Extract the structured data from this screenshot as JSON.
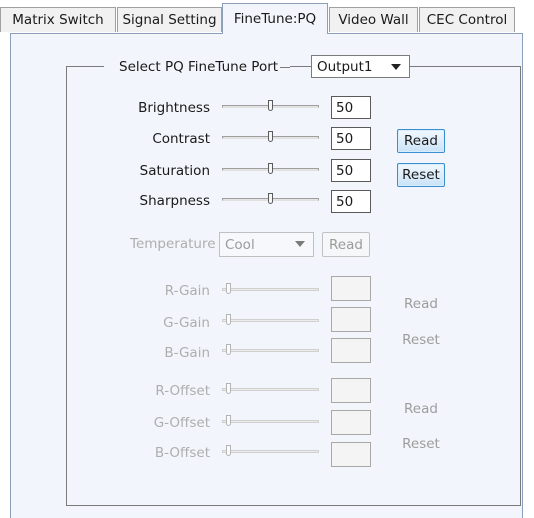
{
  "tabs": [
    {
      "label": "Matrix Switch",
      "active": false
    },
    {
      "label": "Signal Setting",
      "active": false
    },
    {
      "label": "FineTune:PQ",
      "active": true
    },
    {
      "label": "Video Wall",
      "active": false
    },
    {
      "label": "CEC Control",
      "active": false
    }
  ],
  "port": {
    "title": "Select PQ FineTune Port",
    "selected": "Output1"
  },
  "picture": {
    "brightness": {
      "label": "Brightness",
      "value": "50",
      "level": 0.5
    },
    "contrast": {
      "label": "Contrast",
      "value": "50",
      "level": 0.5
    },
    "saturation": {
      "label": "Saturation",
      "value": "50",
      "level": 0.5
    },
    "sharpness": {
      "label": "Sharpness",
      "value": "50",
      "level": 0.5
    },
    "read_label": "Read",
    "reset_label": "Reset"
  },
  "temperature": {
    "label": "Temperature",
    "selected": "Cool",
    "read_label": "Read"
  },
  "gain": {
    "r_label": "R-Gain",
    "g_label": "G-Gain",
    "b_label": "B-Gain",
    "read_label": "Read",
    "reset_label": "Reset"
  },
  "offset": {
    "r_label": "R-Offset",
    "g_label": "G-Offset",
    "b_label": "B-Offset",
    "read_label": "Read",
    "reset_label": "Reset"
  }
}
